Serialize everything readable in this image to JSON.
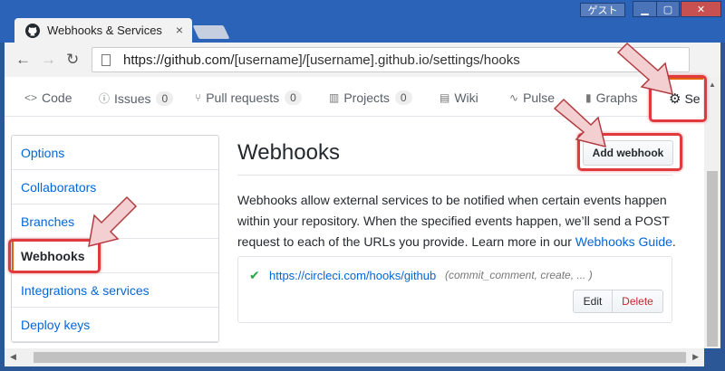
{
  "browser": {
    "tab_title": "Webhooks & Services",
    "tab_close": "×",
    "guest_label": "ゲスト",
    "url_scheme_host": "https://github.com/",
    "url_path": "[username]/[username].github.io/settings/hooks",
    "nav_back": "←",
    "nav_forward": "→",
    "nav_reload": "↻",
    "win_min": "▁",
    "win_max": "▢",
    "win_close": "✕"
  },
  "reponav": {
    "code": {
      "icon": "<>",
      "label": "Code"
    },
    "issues": {
      "icon": "ⓘ",
      "label": "Issues",
      "count": "0"
    },
    "pulls": {
      "icon": "⑂",
      "label": "Pull requests",
      "count": "0"
    },
    "projects": {
      "icon": "▥",
      "label": "Projects",
      "count": "0"
    },
    "wiki": {
      "icon": "▤",
      "label": "Wiki"
    },
    "pulse": {
      "icon": "∿",
      "label": "Pulse"
    },
    "graphs": {
      "icon": "▮",
      "label": "Graphs"
    },
    "settings": {
      "icon": "⚙",
      "label": "Se"
    }
  },
  "sidebar": {
    "items": [
      {
        "label": "Options"
      },
      {
        "label": "Collaborators"
      },
      {
        "label": "Branches"
      },
      {
        "label": "Webhooks"
      },
      {
        "label": "Integrations & services"
      },
      {
        "label": "Deploy keys"
      }
    ]
  },
  "main": {
    "title": "Webhooks",
    "add_button": "Add webhook",
    "description": "Webhooks allow external services to be notified when certain events happen within your repository. When the specified events happen, we’ll send a POST request to each of the URLs you provide. Learn more in our ",
    "guide_link": "Webhooks Guide",
    "description_end": "."
  },
  "hook": {
    "status_icon": "✔",
    "url": "https://circleci.com/hooks/github",
    "events": "(commit_comment, create, ... )",
    "edit_label": "Edit",
    "delete_label": "Delete"
  },
  "colors": {
    "highlight": "#e0393e",
    "link": "#0366d6",
    "active_accent": "#e36209"
  }
}
